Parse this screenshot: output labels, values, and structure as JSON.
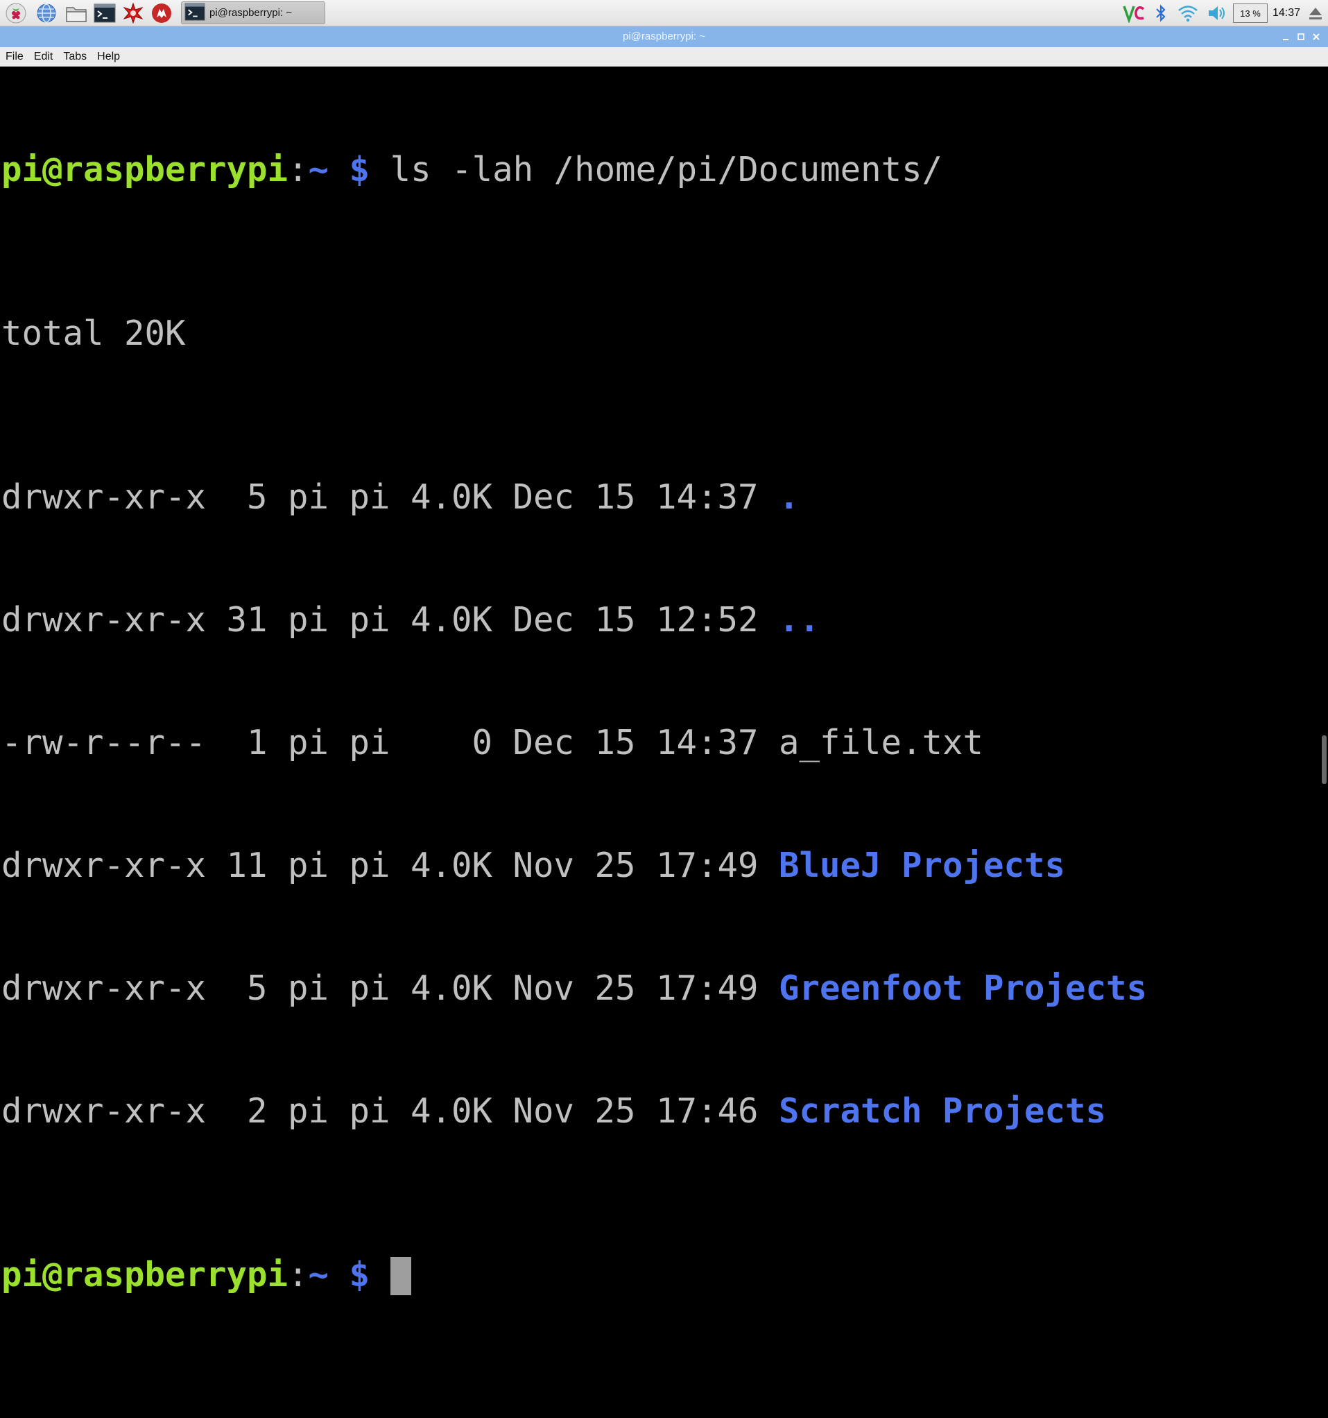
{
  "taskbar": {
    "launchers": [
      {
        "icon": "raspberry-menu-icon"
      },
      {
        "icon": "web-browser-icon"
      },
      {
        "icon": "file-manager-icon"
      },
      {
        "icon": "terminal-icon"
      },
      {
        "icon": "mathematica-icon"
      },
      {
        "icon": "wolfram-icon"
      }
    ],
    "task_window": {
      "icon": "terminal-icon",
      "label": "pi@raspberrypi: ~"
    },
    "tray": {
      "vnc_icon": "vnc-icon",
      "bluetooth_icon": "bluetooth-icon",
      "wifi_icon": "wifi-icon",
      "volume_icon": "volume-icon",
      "cpu_usage": "13 %",
      "clock": "14:37",
      "eject_icon": "eject-icon"
    }
  },
  "window": {
    "title": "pi@raspberrypi: ~",
    "controls": [
      "minimize-icon",
      "maximize-icon",
      "close-icon"
    ]
  },
  "menu": {
    "items": [
      "File",
      "Edit",
      "Tabs",
      "Help"
    ]
  },
  "terminal": {
    "prompt_user": "pi@raspberrypi",
    "prompt_colon": ":",
    "prompt_tilde": "~",
    "prompt_dollar": " $",
    "command": " ls -lah /home/pi/Documents/",
    "total": "total 20K",
    "listing": [
      {
        "meta": "drwxr-xr-x  5 pi pi 4.0K Dec 15 14:37 ",
        "name": ".",
        "is_dir": true
      },
      {
        "meta": "drwxr-xr-x 31 pi pi 4.0K Dec 15 12:52 ",
        "name": "..",
        "is_dir": true
      },
      {
        "meta": "-rw-r--r--  1 pi pi    0 Dec 15 14:37 ",
        "name": "a_file.txt",
        "is_dir": false
      },
      {
        "meta": "drwxr-xr-x 11 pi pi 4.0K Nov 25 17:49 ",
        "name": "BlueJ Projects",
        "is_dir": true
      },
      {
        "meta": "drwxr-xr-x  5 pi pi 4.0K Nov 25 17:49 ",
        "name": "Greenfoot Projects",
        "is_dir": true
      },
      {
        "meta": "drwxr-xr-x  2 pi pi 4.0K Nov 25 17:46 ",
        "name": "Scratch Projects",
        "is_dir": true
      }
    ]
  },
  "colors": {
    "prompt_user": "#9be02d",
    "prompt_path": "#4e74f0",
    "directory": "#4e74f0",
    "text": "#c0c0c0",
    "title_bar": "#87b5e9"
  }
}
